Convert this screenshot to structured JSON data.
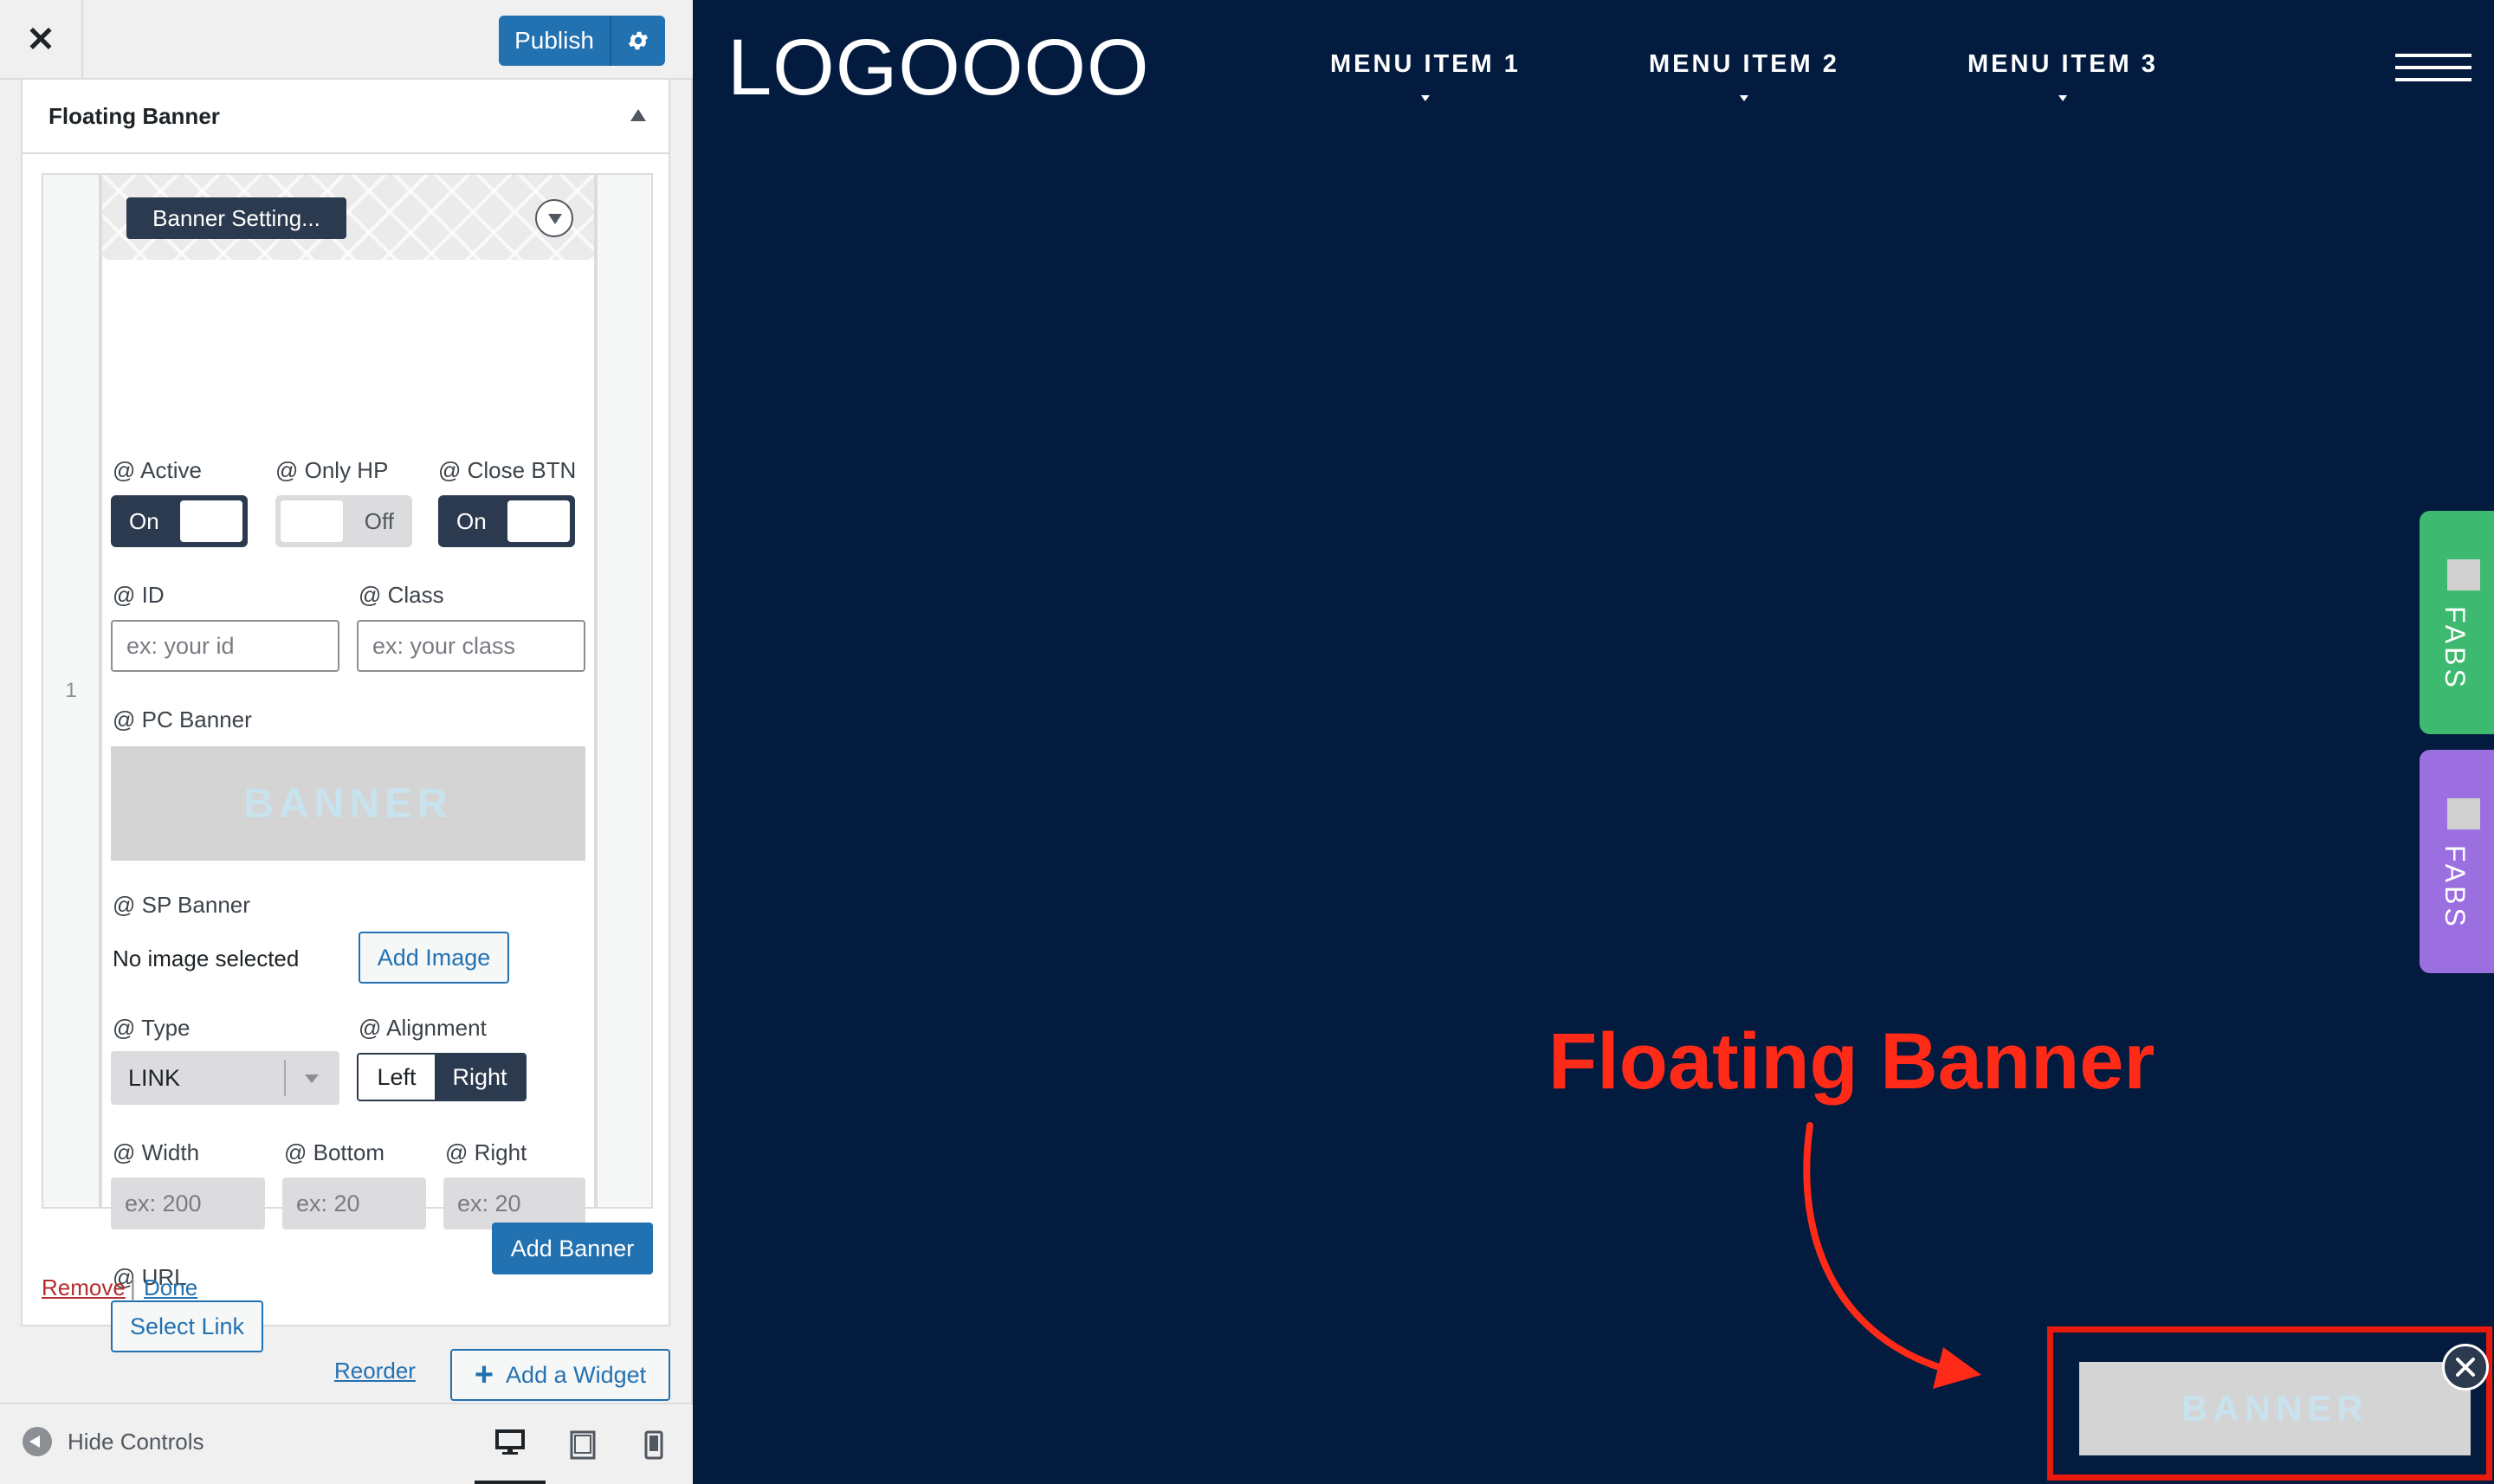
{
  "topbar": {
    "close_glyph": "✕",
    "publish_label": "Publish",
    "settings_icon": "gear-icon"
  },
  "section": {
    "title": "Floating Banner"
  },
  "repeater": {
    "row_number": "1",
    "item_title": "Banner Setting...",
    "fields": {
      "active": {
        "label": "@ Active",
        "state": "On"
      },
      "only_hp": {
        "label": "@ Only HP",
        "state": "Off"
      },
      "close_btn": {
        "label": "@ Close BTN",
        "state": "On"
      },
      "id": {
        "label": "@ ID",
        "placeholder": "ex: your id"
      },
      "class": {
        "label": "@ Class",
        "placeholder": "ex: your class"
      },
      "pc_banner": {
        "label": "@ PC Banner",
        "image_text": "BANNER"
      },
      "sp_banner": {
        "label": "@ SP Banner",
        "status": "No image selected",
        "button": "Add Image"
      },
      "type": {
        "label": "@ Type",
        "value": "LINK"
      },
      "alignment": {
        "label": "@ Alignment",
        "options": [
          "Left",
          "Right"
        ],
        "selected": "Right"
      },
      "width": {
        "label": "@ Width",
        "placeholder": "ex: 200"
      },
      "bottom": {
        "label": "@ Bottom",
        "placeholder": "ex: 20"
      },
      "right": {
        "label": "@ Right",
        "placeholder": "ex: 20"
      },
      "url": {
        "label": "@ URL",
        "button": "Select Link"
      }
    },
    "add_banner": "Add Banner"
  },
  "widget_actions": {
    "remove": "Remove",
    "separator": "|",
    "done": "Done",
    "reorder": "Reorder",
    "add_widget": "Add a Widget"
  },
  "footer": {
    "hide_controls": "Hide Controls",
    "devices": [
      "desktop",
      "tablet",
      "mobile"
    ],
    "active_device": "desktop"
  },
  "preview": {
    "logo": "LOGOOOO",
    "menu": [
      "MENU ITEM 1",
      "MENU ITEM 2",
      "MENU ITEM 3"
    ],
    "fabs": [
      {
        "label": "FABS",
        "color": "#3dba6f"
      },
      {
        "label": "FABS",
        "color": "#9b6fe0"
      }
    ],
    "annotation": "Floating Banner",
    "floating_banner_text": "BANNER"
  },
  "colors": {
    "accent": "#2271b1",
    "preview_bg": "#021b3f",
    "annotation": "#ff2a17",
    "dark_toggle": "#2c3a4f"
  }
}
